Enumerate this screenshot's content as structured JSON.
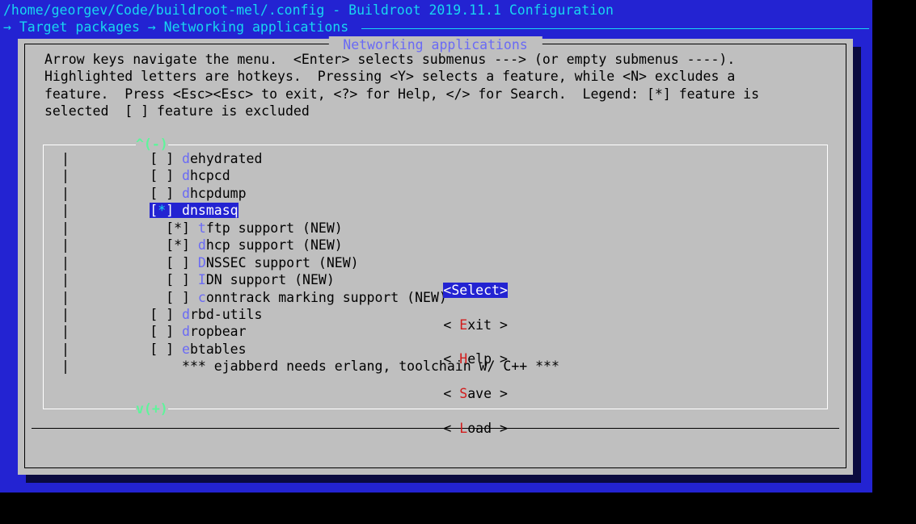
{
  "title_line": "/home/georgev/Code/buildroot-mel/.config - Buildroot 2019.11.1 Configuration",
  "breadcrumb": "→ Target packages → Networking applications ",
  "dialog_title": " Networking applications ",
  "help_text": " Arrow keys navigate the menu.  <Enter> selects submenus ---> (or empty submenus ----).  \n Highlighted letters are hotkeys.  Pressing <Y> selects a feature, while <N> excludes a  \n feature.  Press <Esc><Esc> to exit, <?> for Help, </> for Search.  Legend: [*] feature is\n selected  [ ] feature is excluded",
  "scroll_up": "^(-)",
  "scroll_down": "v(+)",
  "items": [
    {
      "indent": 0,
      "bracket": "[ ]",
      "hot": "d",
      "rest": "ehydrated",
      "selected": false
    },
    {
      "indent": 0,
      "bracket": "[ ]",
      "hot": "d",
      "rest": "hcpcd",
      "selected": false
    },
    {
      "indent": 0,
      "bracket": "[ ]",
      "hot": "d",
      "rest": "hcpdump",
      "selected": false
    },
    {
      "indent": 0,
      "bracket": "[*]",
      "hot": "d",
      "rest": "nsmasq",
      "selected": true
    },
    {
      "indent": 1,
      "bracket": "[*]",
      "hot": "t",
      "rest": "ftp support (NEW)",
      "selected": false
    },
    {
      "indent": 1,
      "bracket": "[*]",
      "hot": "d",
      "rest": "hcp support (NEW)",
      "selected": false
    },
    {
      "indent": 1,
      "bracket": "[ ]",
      "hot": "D",
      "rest": "NSSEC support (NEW)",
      "selected": false
    },
    {
      "indent": 1,
      "bracket": "[ ]",
      "hot": "I",
      "rest": "DN support (NEW)",
      "selected": false
    },
    {
      "indent": 1,
      "bracket": "[ ]",
      "hot": "c",
      "rest": "onntrack marking support (NEW)",
      "selected": false
    },
    {
      "indent": 0,
      "bracket": "[ ]",
      "hot": "d",
      "rest": "rbd-utils",
      "selected": false
    },
    {
      "indent": 0,
      "bracket": "[ ]",
      "hot": "d",
      "rest": "ropbear",
      "selected": false
    },
    {
      "indent": 0,
      "bracket": "[ ]",
      "hot": "e",
      "rest": "btables",
      "selected": false
    },
    {
      "indent": 0,
      "bracket": "   ",
      "hot": "",
      "rest": "*** ejabberd needs erlang, toolchain w/ C++ ***",
      "selected": false
    }
  ],
  "buttons": {
    "select": "<Select>",
    "exit_pre": "< ",
    "exit_hot": "E",
    "exit_post": "xit >",
    "help_pre": "< ",
    "help_hot": "H",
    "help_post": "elp >",
    "save_pre": "< ",
    "save_hot": "S",
    "save_post": "ave >",
    "load_pre": "< ",
    "load_hot": "L",
    "load_post": "oad >"
  }
}
